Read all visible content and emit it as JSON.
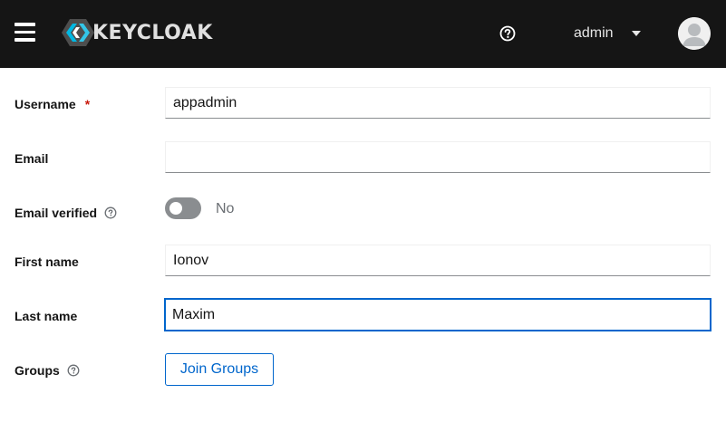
{
  "header": {
    "logo_text": "KEYCLOAK",
    "user": "admin"
  },
  "form": {
    "username": {
      "label": "Username",
      "required_mark": "*",
      "value": "appadmin"
    },
    "email": {
      "label": "Email",
      "value": ""
    },
    "email_verified": {
      "label": "Email verified",
      "state_text": "No"
    },
    "first_name": {
      "label": "First name",
      "value": "Ionov"
    },
    "last_name": {
      "label": "Last name",
      "value": "Maxim"
    },
    "groups": {
      "label": "Groups",
      "button": "Join Groups"
    }
  },
  "colors": {
    "masthead": "#151515",
    "accent": "#0066cc",
    "required": "#c9190b",
    "toggle_off": "#8a8d90"
  }
}
